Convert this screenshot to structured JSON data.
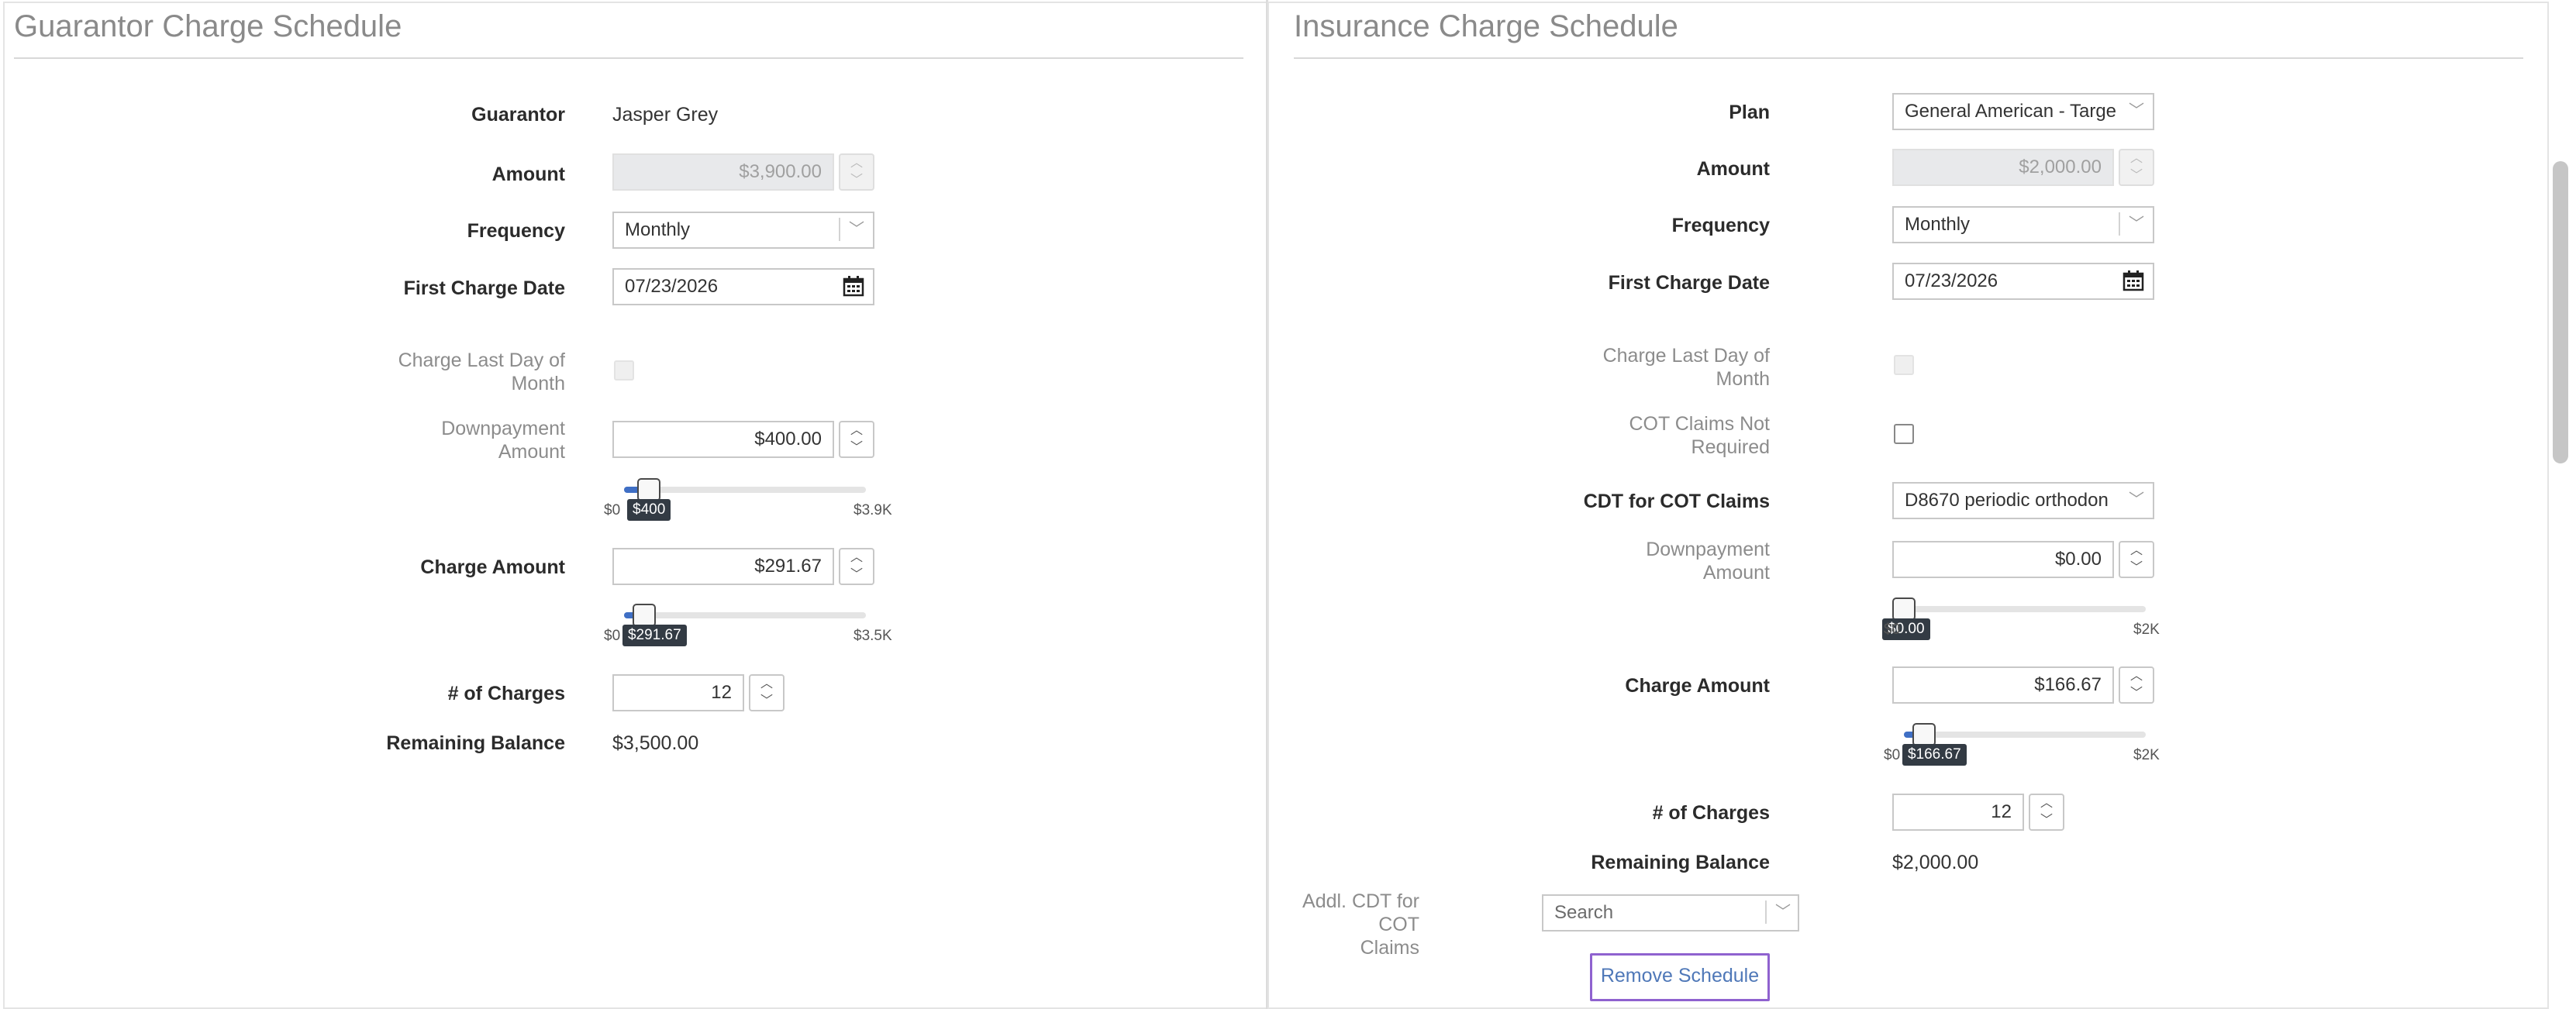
{
  "guarantor": {
    "title": "Guarantor Charge Schedule",
    "guarantor_label": "Guarantor",
    "guarantor_value": "Jasper Grey",
    "amount_label": "Amount",
    "amount_value": "$3,900.00",
    "frequency_label": "Frequency",
    "frequency_value": "Monthly",
    "first_charge_label": "First Charge Date",
    "first_charge_value": "07/23/2026",
    "charge_last_day_label_1": "Charge Last Day of",
    "charge_last_day_label_2": "Month",
    "downpayment_label_1": "Downpayment",
    "downpayment_label_2": "Amount",
    "downpayment_value": "$400.00",
    "downpayment_slider": {
      "min_label": "$0",
      "max_label": "$3.9K",
      "tooltip": "$400",
      "fraction": 0.1026
    },
    "charge_amount_label": "Charge Amount",
    "charge_amount_value": "$291.67",
    "charge_amount_slider": {
      "min_label": "$0",
      "max_label": "$3.5K",
      "tooltip": "$291.67",
      "fraction": 0.0833
    },
    "num_charges_label": "# of Charges",
    "num_charges_value": "12",
    "remaining_label": "Remaining Balance",
    "remaining_value": "$3,500.00"
  },
  "insurance": {
    "title": "Insurance Charge Schedule",
    "plan_label": "Plan",
    "plan_value": "General American - Targe",
    "amount_label": "Amount",
    "amount_value": "$2,000.00",
    "frequency_label": "Frequency",
    "frequency_value": "Monthly",
    "first_charge_label": "First Charge Date",
    "first_charge_value": "07/23/2026",
    "charge_last_day_label_1": "Charge Last Day of",
    "charge_last_day_label_2": "Month",
    "cot_not_required_label_1": "COT Claims Not",
    "cot_not_required_label_2": "Required",
    "cdt_label": "CDT for COT Claims",
    "cdt_value": "D8670 periodic orthodon",
    "downpayment_label_1": "Downpayment",
    "downpayment_label_2": "Amount",
    "downpayment_value": "$0.00",
    "downpayment_slider": {
      "min_label": "$0",
      "max_label": "$2K",
      "tooltip": "$0.00",
      "fraction": 0
    },
    "charge_amount_label": "Charge Amount",
    "charge_amount_value": "$166.67",
    "charge_amount_slider": {
      "min_label": "$0",
      "max_label": "$2K",
      "tooltip": "$166.67",
      "fraction": 0.0833
    },
    "num_charges_label": "# of Charges",
    "num_charges_value": "12",
    "remaining_label": "Remaining Balance",
    "remaining_value": "$2,000.00",
    "addl_cdt_label_1": "Addl. CDT for COT",
    "addl_cdt_label_2": "Claims",
    "addl_cdt_placeholder": "Search",
    "remove_button": "Remove Schedule"
  },
  "icons": {
    "calendar": "calendar-icon",
    "chevron": "chevron-down-icon",
    "spin_up": "chevron-up-icon",
    "spin_down": "chevron-down-icon"
  },
  "colors": {
    "accent": "#3f6fc5",
    "button_border": "#8f62cf",
    "link_text": "#4f78b8",
    "tooltip_bg": "#333b44"
  }
}
